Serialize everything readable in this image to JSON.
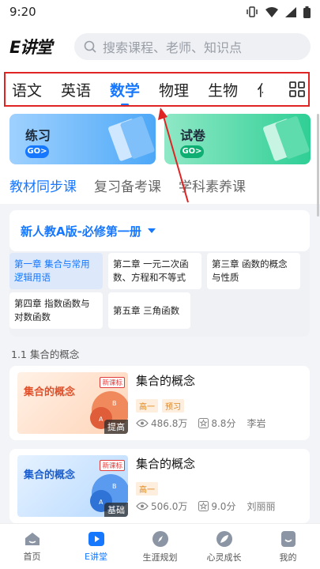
{
  "status": {
    "time": "9:20"
  },
  "header": {
    "logo": "E讲堂",
    "search_placeholder": "搜索课程、老师、知识点"
  },
  "subjects": [
    {
      "label": "语文",
      "active": false
    },
    {
      "label": "英语",
      "active": false
    },
    {
      "label": "数学",
      "active": true
    },
    {
      "label": "物理",
      "active": false
    },
    {
      "label": "生物",
      "active": false
    },
    {
      "label": "化",
      "active": false
    }
  ],
  "cards": {
    "practice_title": "练习",
    "paper_title": "试卷",
    "go_label": "GO>"
  },
  "course_tabs": [
    "教材同步课",
    "复习备考课",
    "学科素养课"
  ],
  "edition": "新人教A版-必修第一册",
  "chapters": [
    "第一章 集合与常用逻辑用语",
    "第二章 一元二次函数、方程和不等式",
    "第三章 函数的概念与性质",
    "第四章 指数函数与对数函数",
    "第五章 三角函数"
  ],
  "section_title": "1.1 集合的概念",
  "courses": [
    {
      "thumb_title": "集合的概念",
      "new_tag": "新课标",
      "level": "提高",
      "name": "集合的概念",
      "tags": [
        "高一",
        "预习"
      ],
      "views": "486.8万",
      "score": "8.8分",
      "teacher": "李岩"
    },
    {
      "thumb_title": "集合的概念",
      "new_tag": "新课标",
      "level": "基础",
      "name": "集合的概念",
      "tags": [
        "高一"
      ],
      "views": "506.0万",
      "score": "9.0分",
      "teacher": "刘丽丽"
    }
  ],
  "bottom_nav": [
    {
      "label": "首页",
      "icon": "home-icon",
      "active": false
    },
    {
      "label": "E讲堂",
      "icon": "play-icon",
      "active": true
    },
    {
      "label": "生涯规划",
      "icon": "compass-icon",
      "active": false
    },
    {
      "label": "心灵成长",
      "icon": "leaf-icon",
      "active": false
    },
    {
      "label": "我的",
      "icon": "profile-icon",
      "active": false
    }
  ],
  "colors": {
    "accent": "#1677ff",
    "highlight_border": "#e02424"
  }
}
